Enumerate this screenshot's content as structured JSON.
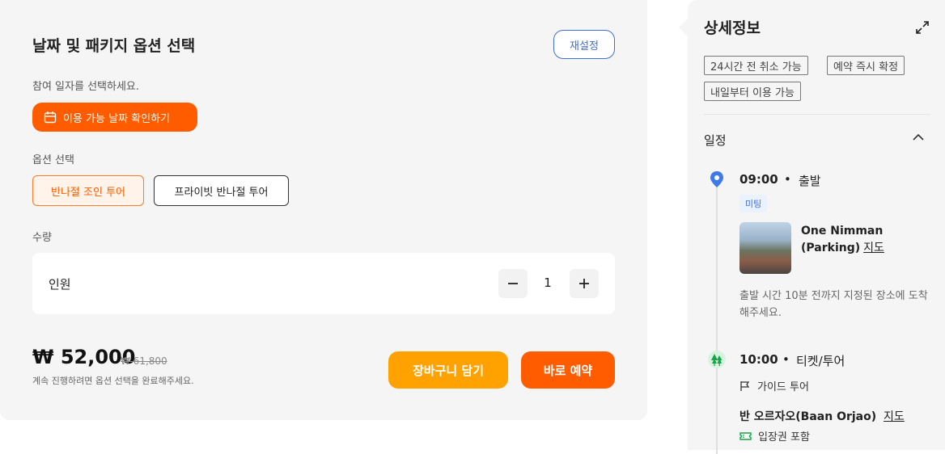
{
  "left": {
    "title": "날짜 및 패키지 옵션 선택",
    "reset_label": "재설정",
    "date_prompt": "참여 일자를 선택하세요.",
    "date_button_label": "이용 가능 날짜 확인하기",
    "option_label": "옵션 선택",
    "options": [
      {
        "label": "반나절 조인 투어",
        "selected": true
      },
      {
        "label": "프라이빗 반나절 투어",
        "selected": false
      }
    ],
    "quantity_label": "수량",
    "quantity_item": "인원",
    "quantity_value": "1",
    "price": "₩ 52,000",
    "original_price": "₩ 61,800",
    "hint": "계속 진행하려면 옵션 선택을 완료해주세요.",
    "cart_label": "장바구니 담기",
    "book_label": "바로 예약"
  },
  "right": {
    "title": "상세정보",
    "tags": [
      "24시간 전 취소 가능",
      "예약 즉시 확정",
      "내일부터 이용 가능"
    ],
    "section_title": "일정",
    "steps": [
      {
        "time": "09:00",
        "sep": "•",
        "name": "출발",
        "badge": "미팅",
        "place_line1": "One Nimman",
        "place_line2": "(Parking)",
        "map_label": "지도",
        "description": "출발 시간 10분 전까지 지정된 장소에 도착해주세요."
      },
      {
        "time": "10:00",
        "sep": "•",
        "name": "티켓/투어",
        "guide_label": "가이드 투어",
        "place": "반 오르자오(Baan Orjao)",
        "map_label": "지도",
        "ticket_label": "입장권 포함"
      }
    ]
  },
  "colors": {
    "accent_orange": "#ff5c00",
    "cart_yellow": "#ffa200",
    "link_blue": "#3f6ed7",
    "panel_bg": "#f5f5f5"
  }
}
